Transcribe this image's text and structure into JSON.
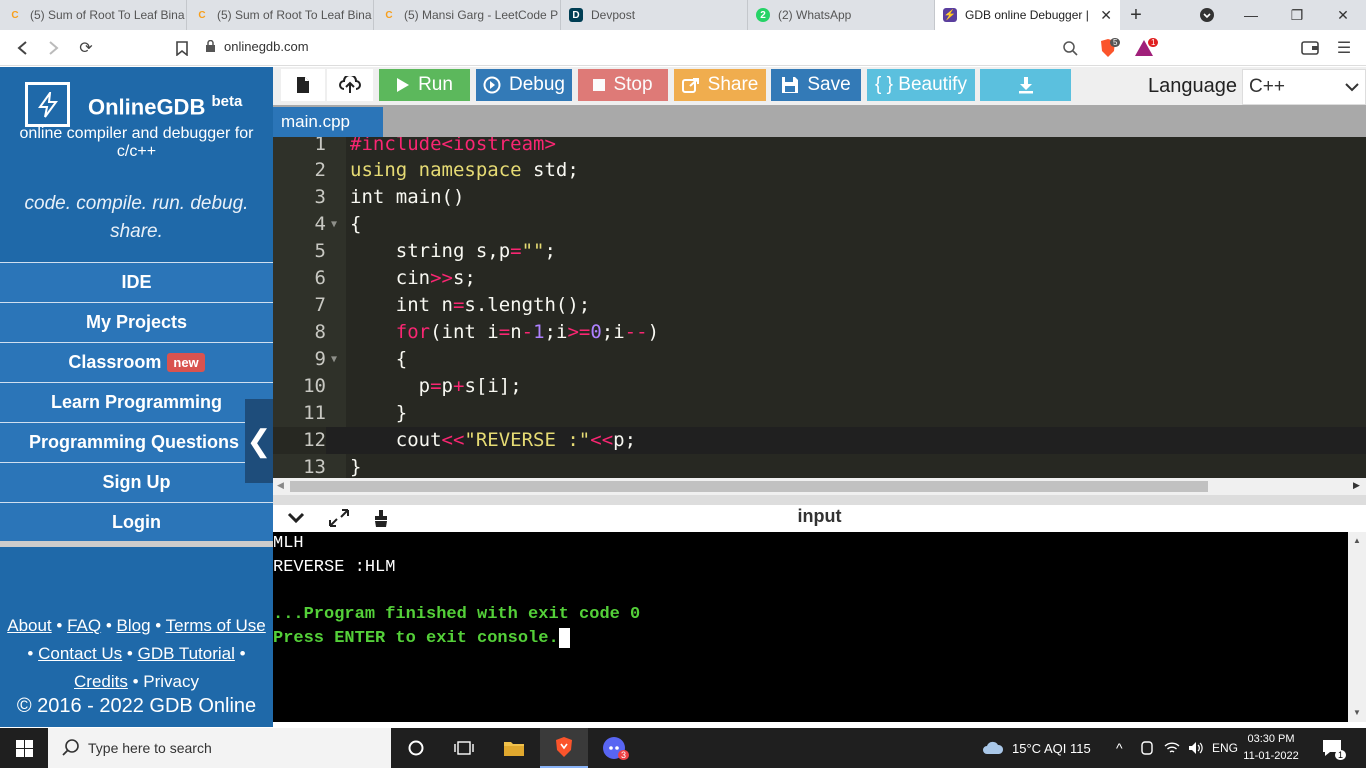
{
  "browser": {
    "tabs": [
      {
        "title": "(5) Sum of Root To Leaf Bina"
      },
      {
        "title": "(5) Sum of Root To Leaf Bina"
      },
      {
        "title": "(5) Mansi Garg - LeetCode P"
      },
      {
        "title": "Devpost"
      },
      {
        "title": "(2) WhatsApp"
      },
      {
        "title": "GDB online Debugger |"
      }
    ],
    "url": "onlinegdb.com",
    "brave_badge": "5",
    "rewards_badge": "1"
  },
  "sidebar": {
    "brand": "OnlineGDB",
    "brand_sup": "beta",
    "tagline": "online compiler and debugger for c/c++",
    "motto": "code. compile. run. debug. share.",
    "menu": [
      {
        "label": "IDE"
      },
      {
        "label": "My Projects"
      },
      {
        "label": "Classroom"
      },
      {
        "label": "Learn Programming"
      },
      {
        "label": "Programming Questions"
      },
      {
        "label": "Sign Up"
      },
      {
        "label": "Login"
      }
    ],
    "new_badge": "new",
    "footer_links": [
      "About",
      "FAQ",
      "Blog",
      "Terms of Use",
      "Contact Us",
      "GDB Tutorial",
      "Credits",
      "Privacy"
    ],
    "copyright": "© 2016 - 2022 GDB Online"
  },
  "toolbar": {
    "run": "Run",
    "debug": "Debug",
    "stop": "Stop",
    "share": "Share",
    "save": "Save",
    "beautify": "{ } Beautify",
    "language_label": "Language",
    "language_value": "C++"
  },
  "file_tab": "main.cpp",
  "editor": {
    "line_numbers": [
      "1",
      "2",
      "3",
      "4",
      "5",
      "6",
      "7",
      "8",
      "9",
      "10",
      "11",
      "12",
      "13"
    ],
    "code_lines": [
      "#include<iostream>",
      "using namespace std;",
      "int main()",
      "{",
      "    string s,p=\"\";",
      "    cin>>s;",
      "    int n=s.length();",
      "    for(int i=n-1;i>=0;i--)",
      "    {",
      "      p=p+s[i];",
      "    }",
      "    cout<<\"REVERSE :\"<<p;",
      "}"
    ]
  },
  "io": {
    "title": "input",
    "console_lines": [
      "MLH",
      "REVERSE :HLM",
      "",
      "...Program finished with exit code 0",
      "Press ENTER to exit console."
    ]
  },
  "taskbar": {
    "search_placeholder": "Type here to search",
    "weather": "15°C  AQI 115",
    "lang": "ENG",
    "time": "03:30 PM",
    "date": "11-01-2022",
    "notif_count": "1",
    "discord_badge": "3"
  },
  "colors": {
    "sidebar_bg": "#1f69a9",
    "run_btn": "#5cb85c",
    "debug_btn": "#337ab7",
    "stop_btn": "#d9534f",
    "share_btn": "#f0ad4e",
    "save_btn": "#337ab7",
    "beautify_btn": "#5bc0de",
    "editor_bg": "#272822"
  }
}
